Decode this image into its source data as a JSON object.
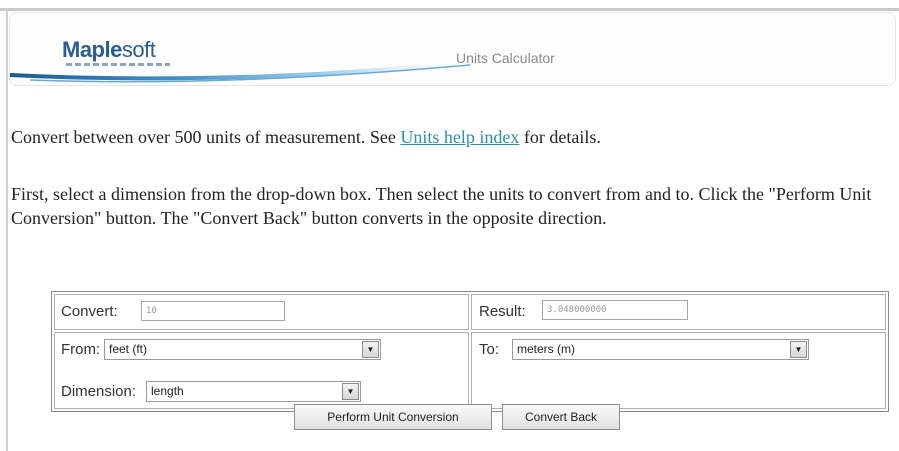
{
  "header": {
    "logo_bold": "Maple",
    "logo_regular": "soft",
    "title": "Units Calculator"
  },
  "intro": {
    "text_before": "Convert between over 500 units of measurement. See ",
    "link": "Units help index",
    "text_after": " for details."
  },
  "instructions": "First, select a dimension from the drop-down box. Then select the units to convert from and to. Click the \"Perform Unit Conversion\" button. The \"Convert Back\" button converts in the opposite direction.",
  "converter": {
    "convert_label": "Convert:",
    "convert_value": "10",
    "result_label": "Result:",
    "result_value": "3.048000000",
    "from_label": "From:",
    "from_selected": "feet (ft)",
    "to_label": "To:",
    "to_selected": "meters (m)",
    "dimension_label": "Dimension:",
    "dimension_selected": "length"
  },
  "buttons": {
    "perform": "Perform Unit Conversion",
    "convert_back": "Convert Back"
  },
  "colors": {
    "link": "#2d8fa6",
    "logo": "#2a5d92"
  }
}
